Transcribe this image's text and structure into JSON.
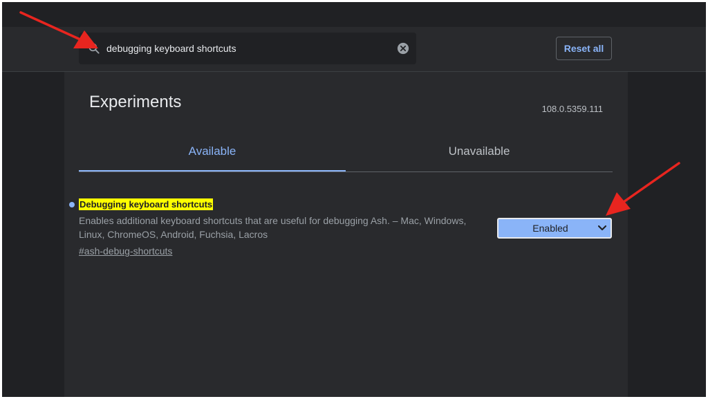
{
  "search": {
    "value": "debugging keyboard shortcuts",
    "search_icon": "search-icon",
    "clear_icon": "clear-icon"
  },
  "header": {
    "reset_label": "Reset all"
  },
  "page": {
    "title": "Experiments",
    "version": "108.0.5359.111"
  },
  "tabs": [
    {
      "label": "Available",
      "active": true
    },
    {
      "label": "Unavailable",
      "active": false
    }
  ],
  "experiment": {
    "name": "Debugging keyboard shortcuts",
    "description": "Enables additional keyboard shortcuts that are useful for debugging Ash. – Mac, Windows, Linux, ChromeOS, Android, Fuchsia, Lacros",
    "link": "#ash-debug-shortcuts",
    "selected_option": "Enabled"
  },
  "colors": {
    "background": "#202124",
    "panel": "#292a2d",
    "accent": "#8ab4f8",
    "highlight": "#ffff00",
    "annotation_arrow": "#e8251f"
  }
}
